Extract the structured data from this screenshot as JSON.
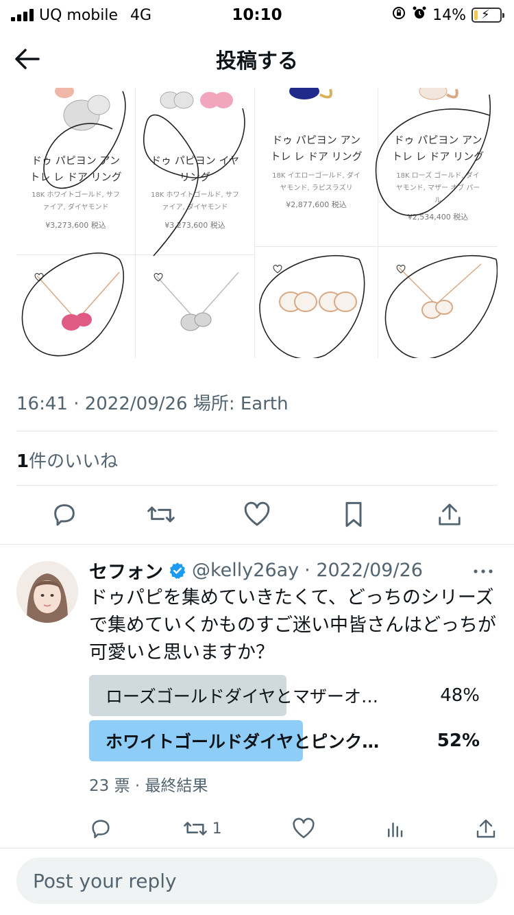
{
  "status_bar": {
    "carrier": "UQ mobile",
    "network": "4G",
    "time": "10:10",
    "battery": "14%",
    "battery_level": 0.14
  },
  "header": {
    "title": "投稿する"
  },
  "product_grid": {
    "products": [
      {
        "name": "ドゥ パピヨン アン\nトレ レ ドア リング",
        "spec": "18K ホワイトゴールド, サフ\nァイア, ダイヤモンド",
        "price": "¥3,273,600 税込"
      },
      {
        "name": "ドゥ パピヨン イヤ\nリング",
        "spec": "18K ホワイトゴールド, サフ\nァイア, ダイヤモンド",
        "price": "¥3,273,600 税込"
      },
      {
        "name": "ドゥ パピヨン アン\nトレ レ ドア リング",
        "spec": "18K イエローゴールド, ダイ\nヤモンド, ラピスラズリ",
        "price": "¥2,877,600 税込"
      },
      {
        "name": "ドゥ パピヨン アン\nトレ レ ドア リング",
        "spec": "18K ローズ ゴールド, ダイ\nヤモンド, マザー オブ パー\nル",
        "price": "¥2,534,400 税込"
      }
    ]
  },
  "tweet_meta": {
    "timestamp": "16:41 · 2022/09/26 場所: Earth",
    "likes_count": "1",
    "likes_label": "件のいいね"
  },
  "reply": {
    "name": "セフォン",
    "handle": "@kelly26ay",
    "date": "· 2022/09/26",
    "text": "ドゥパピを集めていきたくて、どっちのシリーズで集めていくかものすご迷い中皆さんはどっちが可愛いと思いますか？",
    "poll": {
      "options": [
        {
          "label": "ローズゴールドダイヤとマザーオ…",
          "percent_text": "48%",
          "percent": 48,
          "winner": false
        },
        {
          "label": "ホワイトゴールドダイヤとピンク…",
          "percent_text": "52%",
          "percent": 52,
          "winner": true
        }
      ],
      "meta": "23 票 · 最終結果"
    },
    "retweet_count": "1"
  },
  "reply_box": {
    "placeholder": "Post your reply"
  },
  "colors": {
    "accent": "#1d9bf0",
    "poll_winner": "#8ecdf8",
    "poll_loser": "#cfd9de",
    "secondary_text": "#536471",
    "verified": "#1d9bf0"
  }
}
